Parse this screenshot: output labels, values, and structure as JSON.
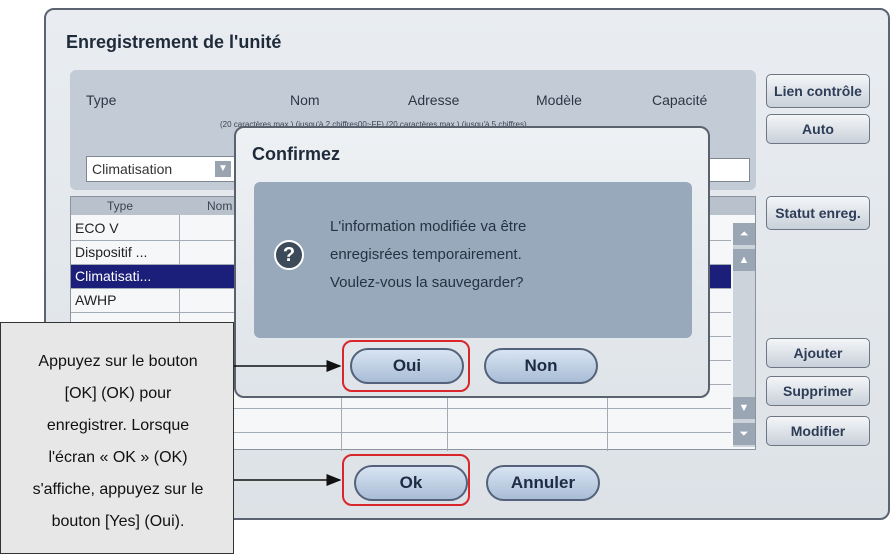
{
  "window": {
    "title": "Enregistrement de l'unité"
  },
  "columns": {
    "type": "Type",
    "nom": "Nom",
    "adresse": "Adresse",
    "modele": "Modèle",
    "capacite": "Capacité",
    "note": "(20 caractères max.) (jusqu'à 2 chiffres00~FF) (20 caractères max.)  (jusqu'à 5 chiffres)"
  },
  "type_select": {
    "value": "Climatisation"
  },
  "table": {
    "headers": [
      "Type",
      "Nom"
    ],
    "rows": [
      {
        "type": "ECO V"
      },
      {
        "type": "Dispositif ..."
      },
      {
        "type": "Climatisati...",
        "selected": true
      },
      {
        "type": "AWHP"
      }
    ]
  },
  "side_buttons": {
    "lien": "Lien contrôle",
    "auto": "Auto",
    "statut": "Statut enreg.",
    "ajouter": "Ajouter",
    "supprimer": "Supprimer",
    "modifier": "Modifier"
  },
  "bottom_buttons": {
    "ok": "Ok",
    "annuler": "Annuler"
  },
  "dialog": {
    "title": "Confirmez",
    "icon": "question-icon",
    "lines": [
      "L'information modifiée va être",
      "enregisrées temporairement.",
      "Voulez-vous la sauvegarder?"
    ],
    "oui": "Oui",
    "non": "Non"
  },
  "callout": {
    "lines": [
      "Appuyez sur le bouton",
      "[OK] (OK) pour",
      "enregistrer. Lorsque",
      "l'écran « OK » (OK)",
      "s'affiche, appuyez sur le",
      "bouton [Yes] (Oui)."
    ]
  },
  "colors": {
    "highlight": "#d8262b",
    "selected_row": "#1b1f7a"
  }
}
